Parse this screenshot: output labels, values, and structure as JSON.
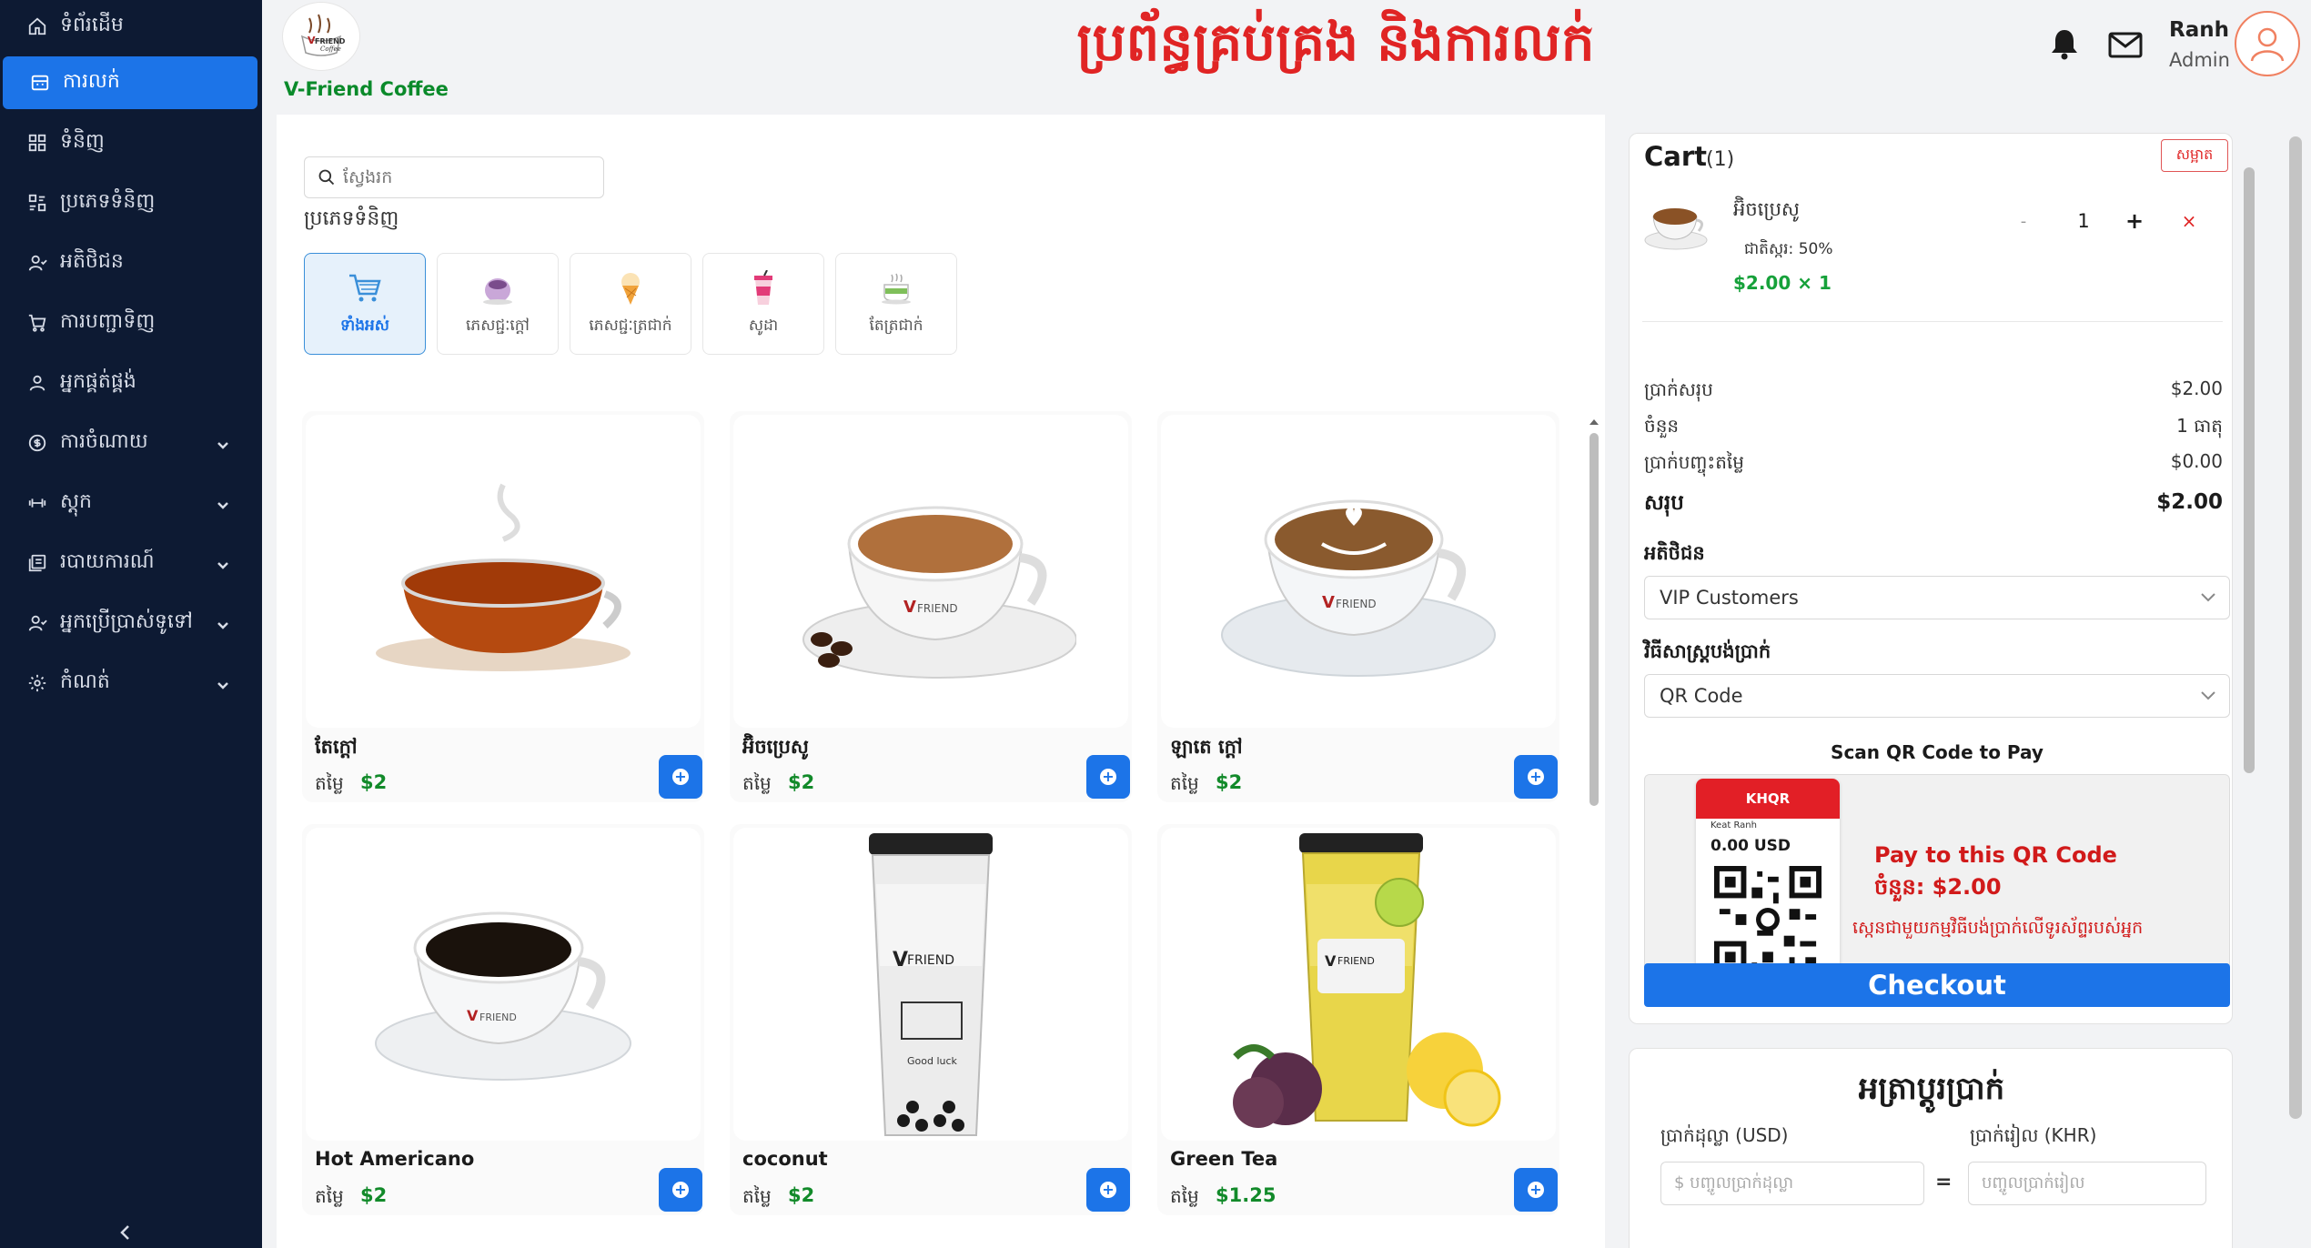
{
  "sidebar": {
    "items": [
      {
        "label": "ទំព័រដើម",
        "icon": "home-icon",
        "active": false,
        "expandable": false
      },
      {
        "label": "ការលក់",
        "icon": "register-icon",
        "active": true,
        "expandable": false
      },
      {
        "label": "ទំនិញ",
        "icon": "grid-icon",
        "active": false,
        "expandable": false
      },
      {
        "label": "ប្រភេទទំនិញ",
        "icon": "category-icon",
        "active": false,
        "expandable": false
      },
      {
        "label": "អតិថិជន",
        "icon": "customers-icon",
        "active": false,
        "expandable": false
      },
      {
        "label": "ការបញ្ជាទិញ",
        "icon": "cart-icon",
        "active": false,
        "expandable": false
      },
      {
        "label": "អ្នកផ្គត់ផ្គង់",
        "icon": "supplier-icon",
        "active": false,
        "expandable": false
      },
      {
        "label": "ការចំណាយ",
        "icon": "expense-icon",
        "active": false,
        "expandable": true
      },
      {
        "label": "ស្តុក",
        "icon": "stock-icon",
        "active": false,
        "expandable": true
      },
      {
        "label": "របាយការណ៍",
        "icon": "report-icon",
        "active": false,
        "expandable": true
      },
      {
        "label": "អ្នកប្រើប្រាស់ទូទៅ",
        "icon": "users-icon",
        "active": false,
        "expandable": true
      },
      {
        "label": "កំណត់",
        "icon": "settings-icon",
        "active": false,
        "expandable": true
      }
    ]
  },
  "header": {
    "brand": "V-Friend Coffee",
    "title": "ប្រព័ន្ធគ្រប់គ្រង និងការលក់",
    "user_name": "Ranh",
    "user_role": "Admin"
  },
  "products": {
    "search_placeholder": "ស្វែងរក",
    "category_title": "ប្រភេទទំនិញ",
    "categories": [
      {
        "label": "ទាំងអស់",
        "icon": "shopping-cart-icon",
        "active": true
      },
      {
        "label": "ភេសជ្ជៈក្តៅ",
        "icon": "hot-drink-icon",
        "active": false
      },
      {
        "label": "ភេសជ្ជៈត្រជាក់",
        "icon": "ice-cream-icon",
        "active": false
      },
      {
        "label": "សូដា",
        "icon": "soda-icon",
        "active": false
      },
      {
        "label": "តែត្រជាក់",
        "icon": "iced-tea-icon",
        "active": false
      }
    ],
    "price_label": "តម្លៃ",
    "items": [
      {
        "name": "តែក្តៅ",
        "price": "$2",
        "image": "hot-tea-image"
      },
      {
        "name": "អ៊ិចប្រេសូ",
        "price": "$2",
        "image": "espresso-image"
      },
      {
        "name": "ឡាតេ ក្តៅ",
        "price": "$2",
        "image": "hot-latte-image"
      },
      {
        "name": "Hot Americano",
        "price": "$2",
        "image": "americano-image"
      },
      {
        "name": "coconut",
        "price": "$2",
        "image": "coconut-drink-image"
      },
      {
        "name": "Green Tea",
        "price": "$1.25",
        "image": "green-tea-image"
      }
    ]
  },
  "cart": {
    "title": "Cart",
    "count": "(1)",
    "clear_label": "សម្អាត",
    "item": {
      "name": "អ៊ិចប្រេសូ",
      "sugar": "ជាតិស្ករ: 50%",
      "price_line": "$2.00 × 1",
      "qty": "1",
      "minus": "-",
      "plus": "+",
      "remove": "×"
    },
    "summary": [
      {
        "label": "ប្រាក់សរុប",
        "value": "$2.00"
      },
      {
        "label": "ចំនួន",
        "value": "1 ធាតុ"
      },
      {
        "label": "ប្រាក់បញ្ចុះតម្លៃ",
        "value": "$0.00"
      }
    ],
    "total_label": "សរុប",
    "total_value": "$2.00",
    "customer_label": "អតិថិជន",
    "customer_value": "VIP Customers",
    "payment_label": "វិធីសាស្រ្តបង់ប្រាក់",
    "payment_value": "QR Code",
    "qr_title": "Scan QR Code to Pay",
    "khqr_brand": "KHQR",
    "khqr_name": "Keat Ranh",
    "khqr_amount": "0.00 USD",
    "qr_pay": "Pay to this QR Code",
    "qr_amount": "ចំនួន: $2.00",
    "qr_hint": "ស្កេនជាមួយកម្មវិធីបង់ប្រាក់លើទូរស័ព្ទរបស់អ្នក",
    "checkout_label": "Checkout"
  },
  "exchange": {
    "title": "អត្រាប្តូរប្រាក់",
    "usd_label": "ប្រាក់ដុល្លា (USD)",
    "khr_label": "ប្រាក់រៀល (KHR)",
    "usd_placeholder": "$ បញ្ចូលប្រាក់ដុល្លា",
    "khr_placeholder": "បញ្ចូលប្រាក់រៀល",
    "equals": "="
  },
  "colors": {
    "sidebar_bg": "#0d1a33",
    "accent": "#1c74e8",
    "title_red": "#e02424",
    "price_green": "#128a2a"
  }
}
